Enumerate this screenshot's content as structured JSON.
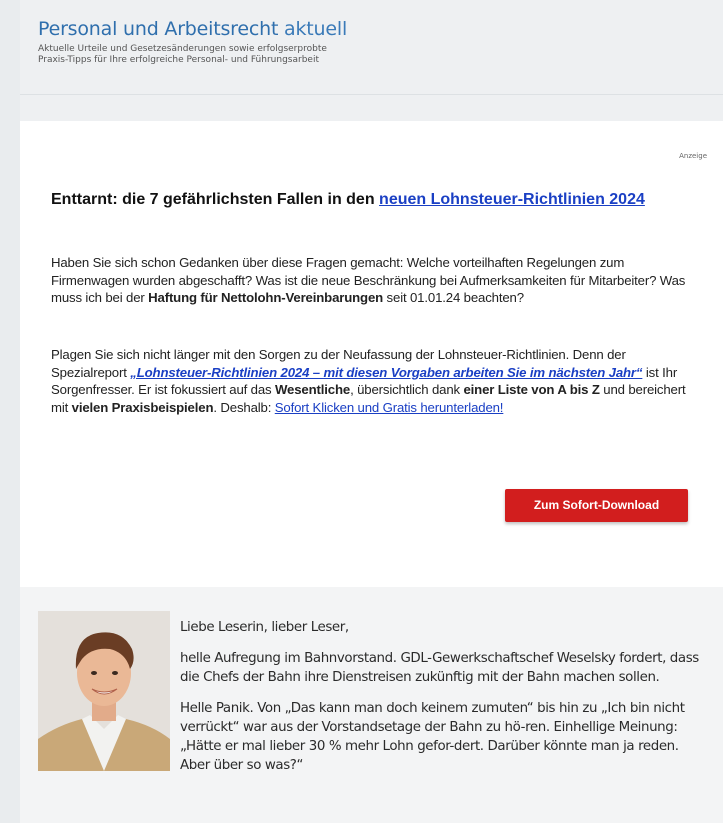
{
  "header": {
    "brand_main": "Personal und Arbeitsrecht",
    "brand_accent": "aktuell",
    "tagline_line1": "Aktuelle Urteile und Gesetzesänderungen sowie erfolgserprobte",
    "tagline_line2": "Praxis-Tipps für Ihre erfolgreiche Personal- und Führungsarbeit"
  },
  "ad": {
    "anzeige_label": "Anzeige",
    "headline_text": "Enttarnt: die 7 gefährlichsten Fallen in den ",
    "headline_link": "neuen Lohnsteuer-Richtlinien 2024",
    "p1_text": "Haben Sie sich schon Gedanken über diese Fragen gemacht: Welche vorteilhaften Regelungen zum Firmenwagen wurden abgeschafft? Was ist die neue Beschränkung bei Aufmerksamkeiten für Mitarbeiter? Was muss ich bei der ",
    "p1_bold": "Haftung für Nettolohn-Vereinbarungen",
    "p1_end": " seit 01.01.24 beachten?",
    "p2_a": "Plagen Sie sich nicht länger mit den Sorgen zu der Neufassung der Lohnsteuer-Richtlinien. Denn der Spezialreport ",
    "p2_report_link": "„Lohnsteuer-Richtlinien 2024 – mit diesen Vorgaben arbeiten Sie im nächsten Jahr“",
    "p2_b": " ist Ihr Sorgenfresser. Er ist fokussiert auf das ",
    "p2_bold1": "Wesentliche",
    "p2_c": ", übersichtlich dank ",
    "p2_bold2": "einer Liste von A bis Z",
    "p2_d": " und bereichert mit ",
    "p2_bold3": "vielen Praxisbeispielen",
    "p2_e": ". Deshalb: ",
    "p2_cta_link": "Sofort Klicken und Gratis herunterladen!",
    "button_label": "Zum Sofort-Download"
  },
  "letter": {
    "greeting": "Liebe Leserin, lieber Leser,",
    "para1": "helle Aufregung im Bahnvorstand. GDL-Gewerkschaftschef Weselsky fordert, dass die Chefs der Bahn ihre Dienstreisen zukünftig mit der Bahn machen sollen.",
    "para2": "Helle Panik. Von „Das kann man doch keinem zumuten“ bis hin zu „Ich bin nicht verrückt“ war aus der Vorstandsetage der Bahn zu hö-ren. Einhellige Meinung: „Hätte er mal lieber 30 % mehr Lohn gefor-dert. Darüber könnte man ja reden. Aber über so was?“"
  },
  "colors": {
    "brand_blue": "#2f6fad",
    "link_blue": "#1a3fc4",
    "button_red": "#d21e1e"
  }
}
